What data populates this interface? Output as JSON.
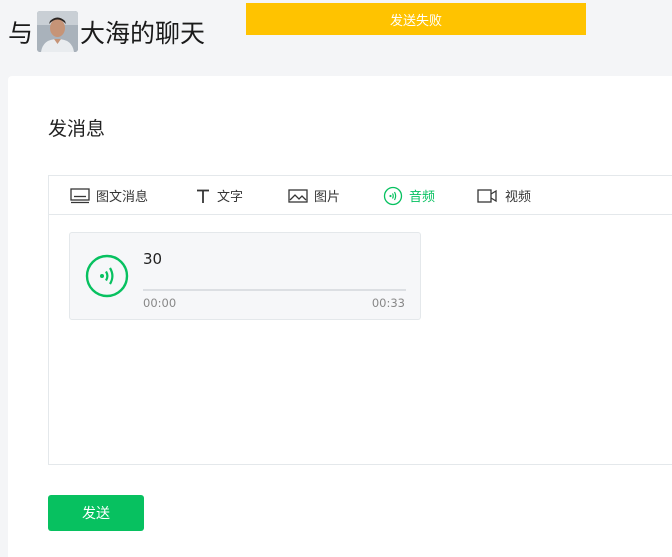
{
  "header": {
    "title_prefix": "与",
    "contact_name": "大海的聊天"
  },
  "toast": {
    "message": "发送失败",
    "color": "#ffc300"
  },
  "composer": {
    "section_title": "发消息",
    "tabs": [
      {
        "label": "图文消息",
        "icon": "article-icon",
        "active": false
      },
      {
        "label": "文字",
        "icon": "text-icon",
        "active": false
      },
      {
        "label": "图片",
        "icon": "image-icon",
        "active": false
      },
      {
        "label": "音频",
        "icon": "audio-icon",
        "active": true
      },
      {
        "label": "视频",
        "icon": "video-icon",
        "active": false
      }
    ],
    "audio": {
      "title": "30",
      "current_time": "00:00",
      "duration": "00:33",
      "progress_fraction": 0
    },
    "send_label": "发送"
  },
  "colors": {
    "accent": "#07c160",
    "toast": "#ffc300"
  }
}
